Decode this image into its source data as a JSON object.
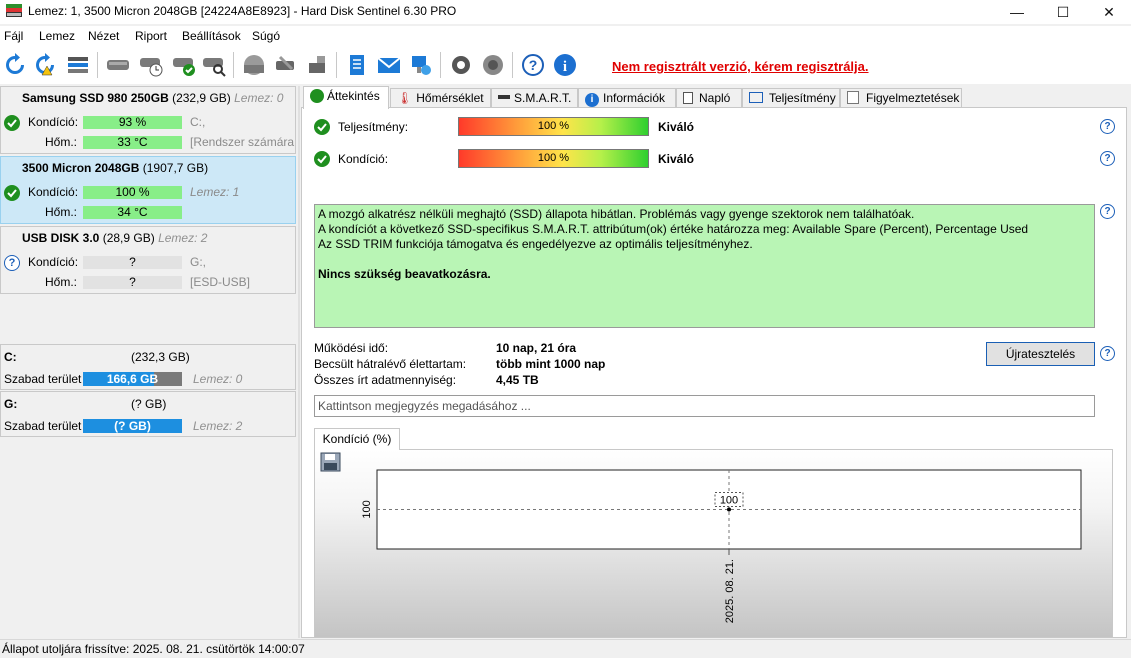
{
  "window": {
    "title": "Lemez: 1, 3500 Micron 2048GB [24224A8E8923]  -  Hard Disk Sentinel 6.30 PRO",
    "minimize": "—",
    "maximize": "☐",
    "close": "✕"
  },
  "menu": [
    "Fájl",
    "Lemez",
    "Nézet",
    "Riport",
    "Beállítások",
    "Súgó"
  ],
  "toolbar": {
    "registration_warning": "Nem regisztrált verzió, kérem regisztrálja.",
    "icons": [
      "refresh-icon",
      "refresh-all-icon",
      "disk-list-icon",
      "disk-icon",
      "disk-schedule-icon",
      "disk-check-icon",
      "disk-search-icon",
      "disk-grey-icon",
      "disk-tools-icon",
      "disk-usb-icon",
      "notepad-icon",
      "mail-icon",
      "network-icon",
      "settings-icon",
      "speaker-icon",
      "help-icon",
      "info-icon"
    ]
  },
  "disks": [
    {
      "name": "Samsung SSD 980 250GB",
      "size": "(232,9 GB)",
      "lemez": "Lemez: 0",
      "condition_label": "Kondíció:",
      "condition": "93 %",
      "condition_fraction": 0.93,
      "temp_label": "Hőm.:",
      "temp": "33 °C",
      "side1": "C:,",
      "side2": "[Rendszer számára f",
      "status": "ok"
    },
    {
      "name": "3500 Micron 2048GB",
      "size": "(1907,7 GB)",
      "lemez": "",
      "condition_label": "Kondíció:",
      "condition": "100 %",
      "condition_fraction": 1.0,
      "temp_label": "Hőm.:",
      "temp": "34 °C",
      "side1": "Lemez: 1",
      "side2": "",
      "status": "ok"
    },
    {
      "name": "USB DISK 3.0",
      "size": "(28,9 GB)",
      "lemez": "Lemez: 2",
      "condition_label": "Kondíció:",
      "condition": "?",
      "temp_label": "Hőm.:",
      "temp": "?",
      "side1": "G:,",
      "side2": "[ESD-USB]",
      "status": "unknown"
    }
  ],
  "partitions": [
    {
      "letter": "C:",
      "size": "(232,3 GB)",
      "free_label": "Szabad terület",
      "free": "166,6 GB",
      "free_fraction": 0.72,
      "lemez": "Lemez: 0"
    },
    {
      "letter": "G:",
      "size": "(? GB)",
      "free_label": "Szabad terület",
      "free": "(? GB)",
      "free_fraction": 1.0,
      "lemez": "Lemez: 2"
    }
  ],
  "tabs": [
    "Áttekintés",
    "Hőmérséklet",
    "S.M.A.R.T.",
    "Információk",
    "Napló",
    "Teljesítmény",
    "Figyelmeztetések"
  ],
  "overview": {
    "performance_label": "Teljesítmény:",
    "performance_value": "100 %",
    "performance_word": "Kiváló",
    "condition_label": "Kondíció:",
    "condition_value": "100 %",
    "condition_word": "Kiváló",
    "summary_lines": [
      "A mozgó alkatrész nélküli meghajtó (SSD) állapota hibátlan. Problémás vagy gyenge szektorok nem találhatóak.",
      "A kondíciót a következő SSD-specifikus S.M.A.R.T. attribútum(ok) értéke határozza meg:  Available Spare (Percent), Percentage Used",
      "Az SSD TRIM funkciója támogatva és engedélyezve az optimális teljesítményhez."
    ],
    "summary_action": "Nincs szükség beavatkozásra.",
    "uptime_label": "Működési idő:",
    "uptime": "10 nap, 21 óra",
    "remaining_label": "Becsült hátralévő élettartam:",
    "remaining": "több mint 1000 nap",
    "written_label": "Összes írt adatmennyiség:",
    "written": "4,45 TB",
    "retest_button": "Újratesztelés",
    "note_placeholder": "Kattintson megjegyzés megadásához ...",
    "chart_tab": "Kondíció  (%)"
  },
  "chart_data": {
    "type": "line",
    "x": [
      "2025. 08. 21."
    ],
    "series": [
      {
        "values": [
          100
        ]
      }
    ],
    "ytick": "100",
    "data_label": "100"
  },
  "status_bar": "Állapot utoljára frissítve: 2025. 08. 21. csütörtök 14:00:07"
}
